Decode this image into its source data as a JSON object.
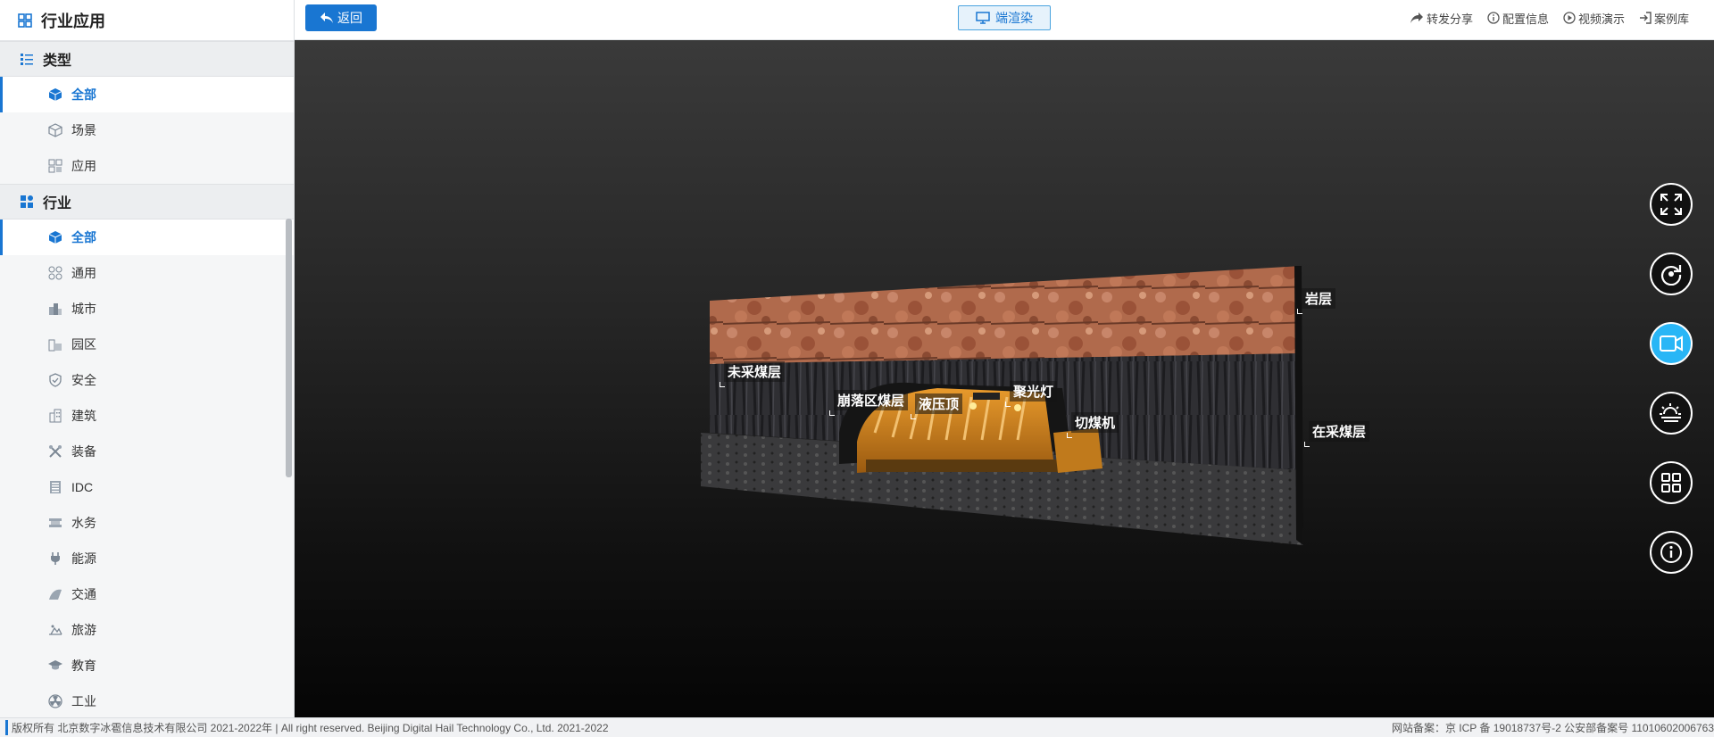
{
  "sidebar": {
    "title": "行业应用",
    "sections": [
      {
        "label": "类型",
        "items": [
          {
            "label": "全部",
            "active": true
          },
          {
            "label": "场景"
          },
          {
            "label": "应用"
          }
        ]
      },
      {
        "label": "行业",
        "items": [
          {
            "label": "全部",
            "active": true
          },
          {
            "label": "通用"
          },
          {
            "label": "城市"
          },
          {
            "label": "园区"
          },
          {
            "label": "安全"
          },
          {
            "label": "建筑"
          },
          {
            "label": "装备"
          },
          {
            "label": "IDC"
          },
          {
            "label": "水务"
          },
          {
            "label": "能源"
          },
          {
            "label": "交通"
          },
          {
            "label": "旅游"
          },
          {
            "label": "教育"
          },
          {
            "label": "工业"
          }
        ]
      }
    ]
  },
  "topbar": {
    "back_label": "返回",
    "render_label": "端渲染",
    "links": [
      "转发分享",
      "配置信息",
      "视频演示",
      "案例库"
    ]
  },
  "scene": {
    "labels": {
      "rock": "岩层",
      "unmined": "未采煤层",
      "collapse": "崩落区煤层",
      "hydraulic": "液压顶",
      "spotlight": "聚光灯",
      "shearer": "切煤机",
      "mining": "在采煤层"
    },
    "machine_plate": "液压顶"
  },
  "right_tools": [
    "fullscreen-icon",
    "rotate-icon",
    "camera-icon",
    "weather-icon",
    "grid-icon",
    "info-icon"
  ],
  "footer": {
    "left": "版权所有 北京数字冰雹信息技术有限公司 2021-2022年 | All right reserved. Beijing Digital Hail Technology Co., Ltd. 2021-2022",
    "right": "网站备案：京 ICP 备 19018737号-2 公安部备案号 11010602006763"
  },
  "colors": {
    "accent": "#1976d2",
    "tool_active": "#29b6f6"
  }
}
